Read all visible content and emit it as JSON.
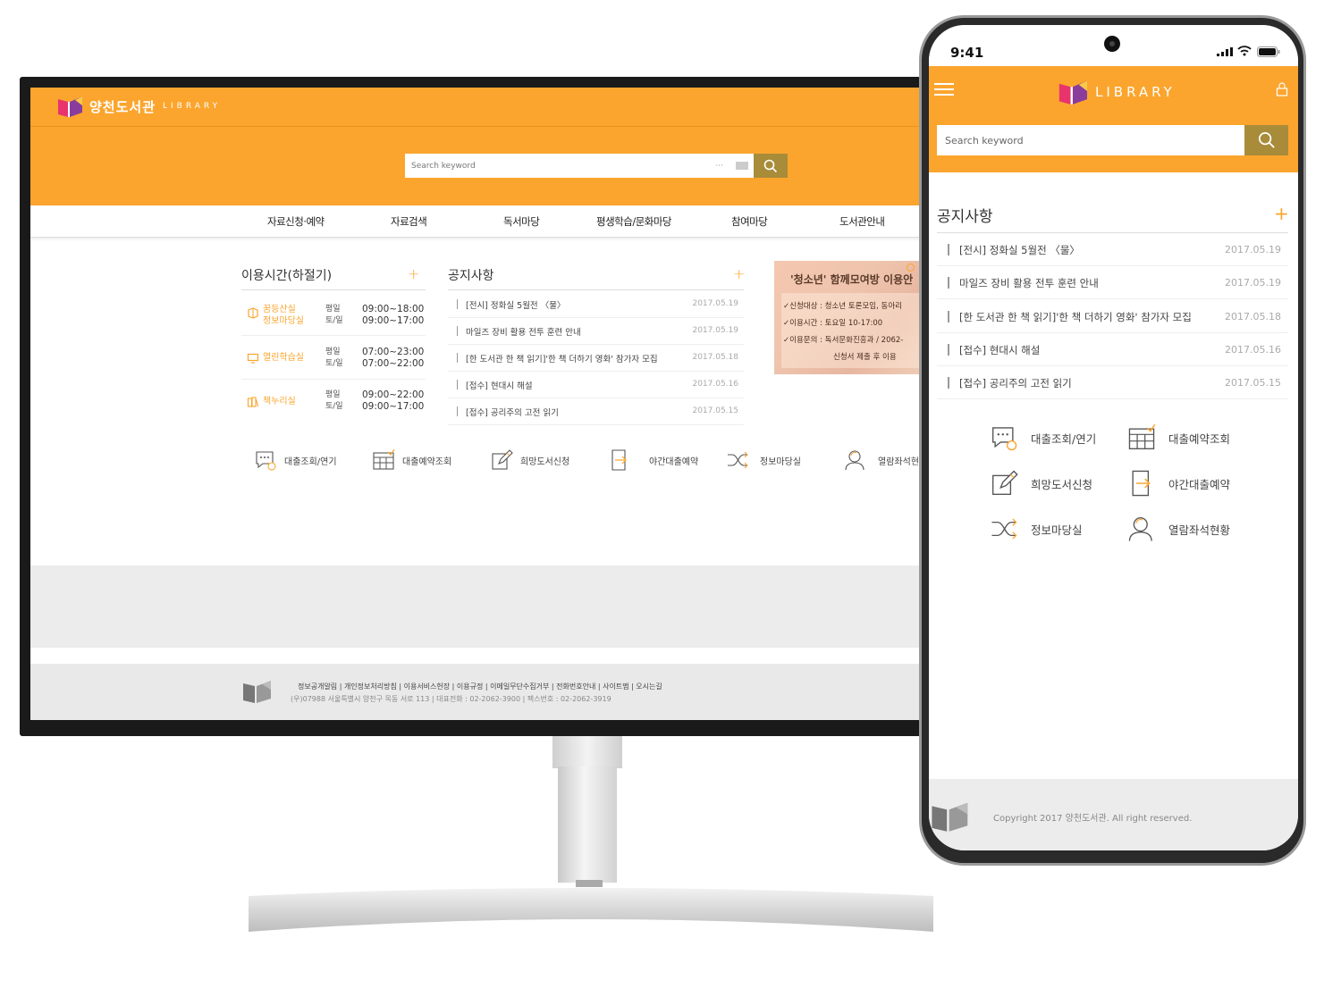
{
  "desktop": {
    "logo": {
      "title": "양천도서관",
      "subtitle": "LIBRARY"
    },
    "search": {
      "placeholder": "Search keyword",
      "dots": "···"
    },
    "nav": [
      "자료신청·예약",
      "자료검색",
      "독서마당",
      "평생학습/문화마당",
      "참여마당",
      "도서관안내"
    ],
    "hours": {
      "title": "이용시간(하절기)",
      "rows": [
        {
          "name1": "꿈등산실",
          "name2": "정보마당실",
          "day1": "평일",
          "day2": "토/일",
          "time1": "09:00~18:00",
          "time2": "09:00~17:00"
        },
        {
          "name1": "열린학습실",
          "name2": "",
          "day1": "평일",
          "day2": "토/일",
          "time1": "07:00~23:00",
          "time2": "07:00~22:00"
        },
        {
          "name1": "책누리실",
          "name2": "",
          "day1": "평일",
          "day2": "토/일",
          "time1": "09:00~22:00",
          "time2": "09:00~17:00"
        }
      ]
    },
    "notice": {
      "title": "공지사항",
      "items": [
        {
          "text": "[전시] 정화실 5월전 〈물〉",
          "date": "2017.05.19"
        },
        {
          "text": "마일즈 장비 활용 전투 훈련 안내",
          "date": "2017.05.19"
        },
        {
          "text": "[한 도서관 한 책 읽기]'한 책 더하기 영화' 참가자 모집",
          "date": "2017.05.18"
        },
        {
          "text": "[접수] 현대시 해설",
          "date": "2017.05.16"
        },
        {
          "text": "[접수] 공리주의 고전 읽기",
          "date": "2017.05.15"
        }
      ]
    },
    "banner": {
      "title": "'청소년' 함께모여방 이용안",
      "lines": [
        "✓신청대상 : 청소년 토론모임, 동아리",
        "✓이용시간 : 토요일 10-17:00",
        "✓이용문의 : 독서문화진흥과 / 2062-",
        "신청서 제출 후 이용"
      ]
    },
    "quick": [
      "대출조회/연기",
      "대출예약조회",
      "희망도서신청",
      "야간대출예약",
      "정보마당실",
      "열람좌석현"
    ],
    "footer": {
      "links": "정보공개알림  |  개인정보처리방침  |  이용서비스헌장  |  이용규정  |  이메일무단수집거부  |  전화번호안내  |  사이트맵  |  오시는길",
      "address": "(우)07988 서울특별시 양천구 목동 서로 113 | 대표전화 : 02-2062-3900 | 팩스번호 : 02-2062-3919"
    }
  },
  "mobile": {
    "status": {
      "time": "9:41"
    },
    "logo": {
      "text": "LIBRARY"
    },
    "search": {
      "placeholder": "Search keyword"
    },
    "notice": {
      "title": "공지사항",
      "items": [
        {
          "text": "[전시] 정화실 5월전 〈물〉",
          "date": "2017.05.19"
        },
        {
          "text": "마일즈 장비 활용 전투 훈련 안내",
          "date": "2017.05.19"
        },
        {
          "text": "[한 도서관 한 책 읽기]'한 책 더하기 영화' 참가자 모집",
          "date": "2017.05.18"
        },
        {
          "text": "[접수] 현대시 해설",
          "date": "2017.05.16"
        },
        {
          "text": "[접수] 공리주의 고전 읽기",
          "date": "2017.05.15"
        }
      ]
    },
    "quick": [
      "대출조회/연기",
      "대출예약조회",
      "희망도서신청",
      "야간대출예약",
      "정보마당실",
      "열람좌석현황"
    ],
    "footer": {
      "copyright": "Copyright 2017 양천도서관. All right reserved."
    }
  },
  "colors": {
    "accent": "#fba52e",
    "search_button": "#a88c3a",
    "logo_pink": "#e8336d",
    "logo_purple": "#8a3c9c"
  }
}
